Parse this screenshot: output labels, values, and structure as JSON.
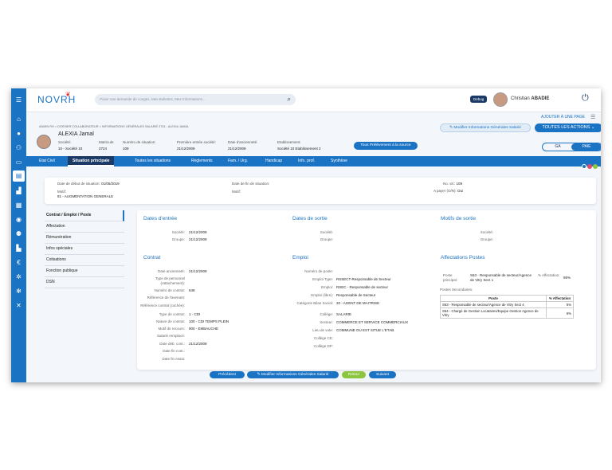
{
  "app": {
    "logo": "NOVRH",
    "logo_icon": "leaf-mark"
  },
  "topbar": {
    "search_placeholder": "Poser une demande de congés, Mes Bulletins, Mes Informations...",
    "debug_label": "Debug",
    "user_first": "Christian",
    "user_last": "ABADIE"
  },
  "header": {
    "add_page": "AJOUTER À UNE PAGE",
    "breadcrumb": "ADMIN RH  >  DOSSIER COLLABORATEUR  >  INFORMATIONS GÉNÉRALES SALARIÉ 2724 - ALEXIA JAMAL",
    "employee_name": "ALEXIA  Jamal",
    "fields": [
      {
        "label": "Société:",
        "value": "10 - Société 10"
      },
      {
        "label": "Matricule:",
        "value": "2724"
      },
      {
        "label": "Numéro de situation:",
        "value": "109"
      },
      {
        "label": "Première entrée société:",
        "value": "21/12/2009"
      },
      {
        "label": "Date d'ancienneté:",
        "value": "21/12/2009"
      },
      {
        "label": "Etablissement:",
        "value": "Société 10 Etablissement 2"
      }
    ],
    "btn_modify": "Modifier Informations Générales Salarié",
    "btn_actions": "TOUTES LES ACTIONS",
    "btn_prelevement": "Tous Prélèvement à la source",
    "toggle_ga": "GA",
    "toggle_paie": "PAIE"
  },
  "tabs": [
    "Etat Civil",
    "Situation principale",
    "Toutes les situations",
    "Règlements",
    "Fam. / Urg.",
    "Handicap",
    "Info. prof.",
    "Synthèse"
  ],
  "active_tab": "Situation principale",
  "situation": {
    "date_debut_label": "Date de début de situation:",
    "date_debut": "01/05/2019",
    "date_fin_label": "Date de fin de situation:",
    "date_fin": "",
    "motif_label": "Motif:",
    "motif": "81 - AUGMENTATION GENERALE",
    "motif2_label": "Motif:",
    "motif2": "",
    "no_sit_label": "No. sit.:",
    "no_sit": "109",
    "a_payer_label": "A payer (O/N):",
    "a_payer": "Oui"
  },
  "leftnav": [
    "Contrat / Emploi / Poste",
    "Affectation",
    "Rémunération",
    "Infos spéciales",
    "Cotisations",
    "Fonction publique",
    "DSN"
  ],
  "sections": {
    "dates_entree": {
      "title": "Dates d'entrée",
      "rows": [
        {
          "label": "Société:",
          "value": "21/12/2009"
        },
        {
          "label": "Groupe:",
          "value": "21/12/2009"
        }
      ]
    },
    "dates_sortie": {
      "title": "Dates de sortie",
      "rows": [
        {
          "label": "Société:",
          "value": ""
        },
        {
          "label": "Groupe:",
          "value": ""
        }
      ]
    },
    "motifs_sortie": {
      "title": "Motifs de sortie",
      "rows": [
        {
          "label": "Société:",
          "value": ""
        },
        {
          "label": "Groupe:",
          "value": ""
        }
      ]
    },
    "contrat": {
      "title": "Contrat",
      "rows": [
        {
          "label": "Date ancienneté:",
          "value": "21/12/2009"
        },
        {
          "label": "Type de personnel (rattachement):",
          "value": ""
        },
        {
          "label": "Numéro de contrat:",
          "value": "648"
        },
        {
          "label": "Référence de l'avenant:",
          "value": ""
        },
        {
          "label": "Référence contrat (cachée):",
          "value": ""
        },
        {
          "label": "Type de contrat:",
          "value": "1 - CDI"
        },
        {
          "label": "Nature de contrat:",
          "value": "100 - CDI TEMPS PLEIN"
        },
        {
          "label": "Motif de recours:",
          "value": "900 - EMBAUCHE"
        },
        {
          "label": "Salarié remplacé:",
          "value": ""
        },
        {
          "label": "Date déb. cont.:",
          "value": "21/12/2009"
        },
        {
          "label": "Date fin cont.:",
          "value": ""
        },
        {
          "label": "Date fin essai:",
          "value": ""
        }
      ]
    },
    "emploi": {
      "title": "Emploi",
      "rows": [
        {
          "label": "Numéro de poste:",
          "value": ""
        },
        {
          "label": "Emploi Type:",
          "value": "RSSECT-Responsable de Secteur"
        },
        {
          "label": "Emploi:",
          "value": "RSEC - Responsable de secteur"
        },
        {
          "label": "Emploi (libre):",
          "value": "Responsable de Secteur"
        },
        {
          "label": "Catégorie Bilan Social:",
          "value": "20 - AGENT DE MAITRISE"
        },
        {
          "label": "Collège:",
          "value": "SALARIE"
        },
        {
          "label": "Secteur:",
          "value": "COMMERCE ET SERVICE COMMERCIAUX"
        },
        {
          "label": "Lieu de vote:",
          "value": "COMMUNE OU EST SITUE L'ETAB."
        },
        {
          "label": "Collège CE:",
          "value": ""
        },
        {
          "label": "Collège DP:",
          "value": ""
        }
      ]
    },
    "affectations": {
      "title": "Affectations Postes",
      "poste_principal_label": "Poste principal:",
      "poste_principal": "S63 - Responsable de secteur/Agence de Vitry Sect 1",
      "pct_label": "% Affectation:",
      "pct": "95%",
      "secondaires_label": "Postes Secondaires:",
      "table_headers": [
        "Poste",
        "% Affectation"
      ],
      "table_rows": [
        [
          "S63 - Responsable de secteur/Agence de Vitry Sect 4",
          "5%"
        ],
        [
          "S64 - Chargé de Gestion Locataires/Equipe Gestion Agence de Vitry",
          "6%"
        ]
      ]
    }
  },
  "footer": {
    "btn_precedent": "Précédent",
    "btn_modifier": "Modifier Informations Générales Salarié",
    "btn_retour": "Retour",
    "btn_suivant": "Suivant"
  },
  "colors": {
    "primary": "#1b73c4",
    "dark": "#1b3b66",
    "retour": "#8cc63f"
  }
}
